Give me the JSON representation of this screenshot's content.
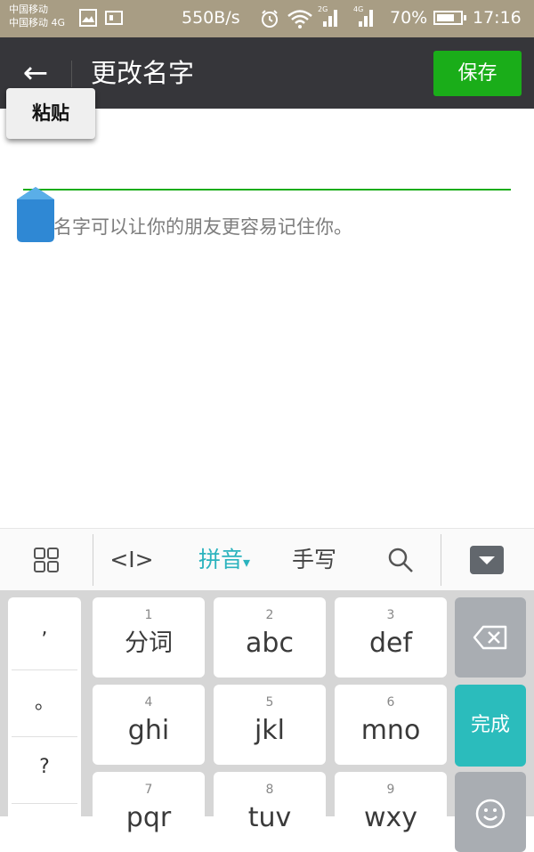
{
  "status_bar": {
    "carrier_1": "中国移动",
    "carrier_2": "中国移动 4G",
    "speed": "550B/s",
    "net_2g": "2G",
    "net_4g": "4G",
    "battery": "70%",
    "time": "17:16"
  },
  "title_bar": {
    "back_glyph": "←",
    "title": "更改名字",
    "save_label": "保存"
  },
  "context_menu": {
    "paste_label": "粘贴"
  },
  "name_input": {
    "value": "",
    "hint": "名字可以让你的朋友更容易记住你。"
  },
  "keyboard_toolbar": {
    "cursor_glyph": "<I>",
    "pinyin_label": "拼音",
    "pinyin_arrow": "▾",
    "handwriting_label": "手写"
  },
  "keyboard": {
    "punctuation": [
      ",",
      "。",
      "?"
    ],
    "keys": [
      {
        "num": "1",
        "label": "分词"
      },
      {
        "num": "2",
        "label": "abc"
      },
      {
        "num": "3",
        "label": "def"
      },
      {
        "num": "4",
        "label": "ghi"
      },
      {
        "num": "5",
        "label": "jkl"
      },
      {
        "num": "6",
        "label": "mno"
      },
      {
        "num": "7",
        "label": "pqr"
      },
      {
        "num": "8",
        "label": "tuv"
      },
      {
        "num": "9",
        "label": "wxy"
      }
    ],
    "done_label": "完成"
  },
  "colors": {
    "accent_green": "#1aad19",
    "title_bar": "#36363a",
    "status_bar": "#a89d84",
    "pinyin_teal": "#2bb3be",
    "done_teal": "#2bbcbc",
    "backspace_gray": "#a9adb2"
  }
}
